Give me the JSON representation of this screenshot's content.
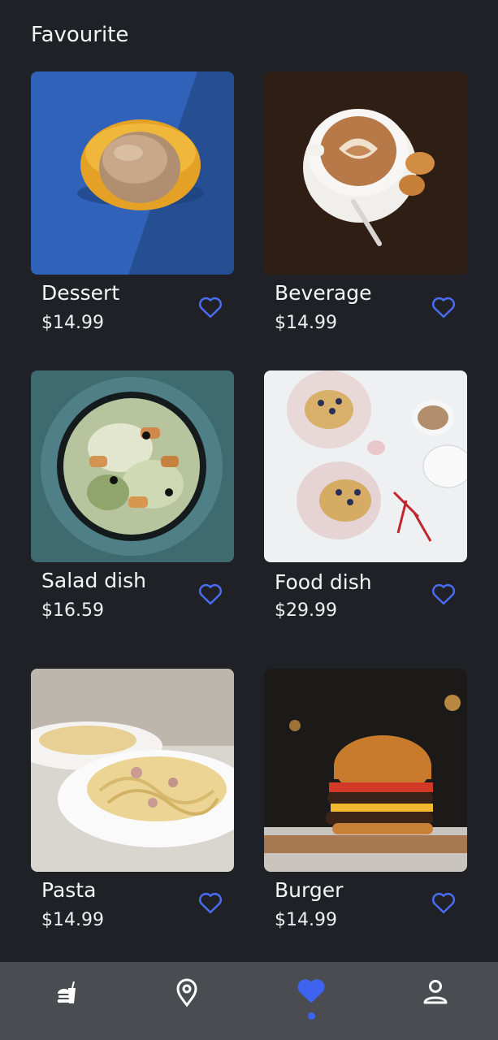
{
  "header": {
    "title": "Favourite"
  },
  "items": [
    {
      "name": "Dessert",
      "price": "$14.99",
      "image_icon": "ice-cream-bowl"
    },
    {
      "name": "Beverage",
      "price": "$14.99",
      "image_icon": "latte-cup"
    },
    {
      "name": "Salad dish",
      "price": "$16.59",
      "image_icon": "salad-bowl"
    },
    {
      "name": "Food dish",
      "price": "$29.99",
      "image_icon": "waffle-plates"
    },
    {
      "name": "Pasta",
      "price": "$14.99",
      "image_icon": "pasta-plate"
    },
    {
      "name": "Burger",
      "price": "$14.99",
      "image_icon": "burger"
    }
  ],
  "nav": {
    "items": [
      {
        "icon": "fast-food-icon",
        "active": false
      },
      {
        "icon": "location-pin-icon",
        "active": false
      },
      {
        "icon": "heart-icon",
        "active": true
      },
      {
        "icon": "profile-icon",
        "active": false
      }
    ]
  },
  "colors": {
    "background": "#1f2126",
    "accent": "#3d63f0",
    "nav_background": "#4a4c52"
  }
}
